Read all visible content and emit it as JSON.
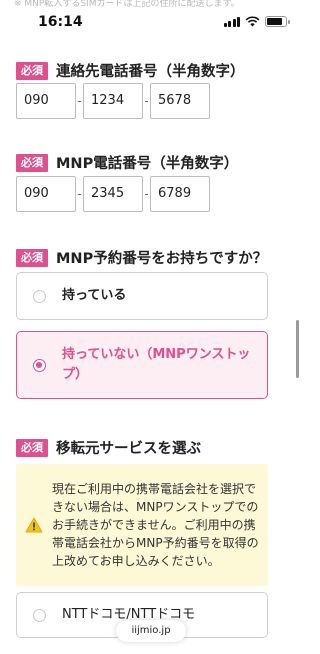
{
  "top_ghost_text": "※ MNP転入するSIMカードは上記の住所に配送します。",
  "status_bar": {
    "time": "16:14",
    "battery_level": 0.85
  },
  "required_label": "必須",
  "contact_phone": {
    "title": "連絡先電話番号（半角数字）",
    "parts": [
      "090",
      "1234",
      "5678"
    ],
    "separator": "-"
  },
  "mnp_phone": {
    "title": "MNP電話番号（半角数字）",
    "parts": [
      "090",
      "2345",
      "6789"
    ],
    "separator": "-"
  },
  "mnp_reservation": {
    "title": "MNP予約番号をお持ちですか？",
    "options": [
      {
        "label": "持っている",
        "selected": false
      },
      {
        "label": "持っていない（MNPワンストップ）",
        "selected": true
      }
    ]
  },
  "transfer_source": {
    "title": "移転元サービスを選ぶ",
    "notice": "現在ご利用中の携帯電話会社を選択できない場合は、MNPワンストップでのお手続きができません。ご利用中の携帯電話会社からMNP予約番号を取得の上改めてお申し込みください。",
    "first_option": "NTTドコモ/NTTドコモ"
  },
  "url_bar": {
    "domain": "iijmio.jp"
  },
  "colors": {
    "accent": "#e04f8e",
    "notice_bg": "#fdf9d6",
    "warning": "#f0c419"
  }
}
